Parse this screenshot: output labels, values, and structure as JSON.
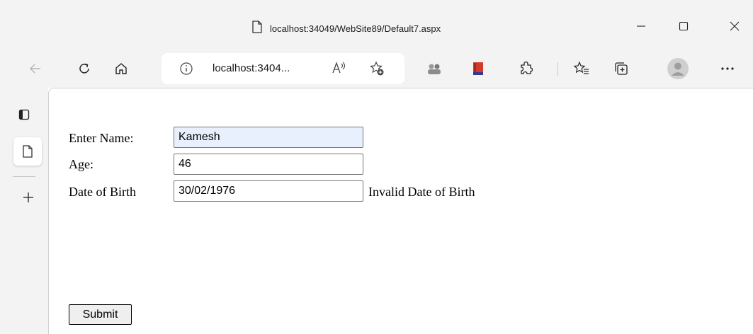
{
  "window": {
    "title": "localhost:34049/WebSite89/Default7.aspx",
    "icons": [
      "page-icon",
      "minimize-icon",
      "maximize-icon",
      "close-icon"
    ]
  },
  "toolbar": {
    "address": "localhost:3404...",
    "icons": [
      "back-icon",
      "refresh-icon",
      "home-icon",
      "info-icon",
      "read-aloud-icon",
      "add-favorite-icon",
      "extension-avatar-icon",
      "extension-book-icon",
      "extensions-icon",
      "favorites-icon",
      "collections-icon",
      "profile-icon",
      "more-icon"
    ]
  },
  "sidebar": {
    "icons": [
      "tab-actions-icon",
      "page-tab-icon",
      "new-tab-icon"
    ]
  },
  "form": {
    "name_label": "Enter Name:",
    "name_value": "Kamesh",
    "age_label": "Age:",
    "age_value": "46",
    "dob_label": "Date of Birth",
    "dob_value": "30/02/1976",
    "dob_error": "Invalid Date of Birth",
    "submit_label": "Submit"
  },
  "colors": {
    "chrome_bg": "#f3f3f3",
    "autofill_bg": "#e8f0fe",
    "field_border": "#767676"
  }
}
